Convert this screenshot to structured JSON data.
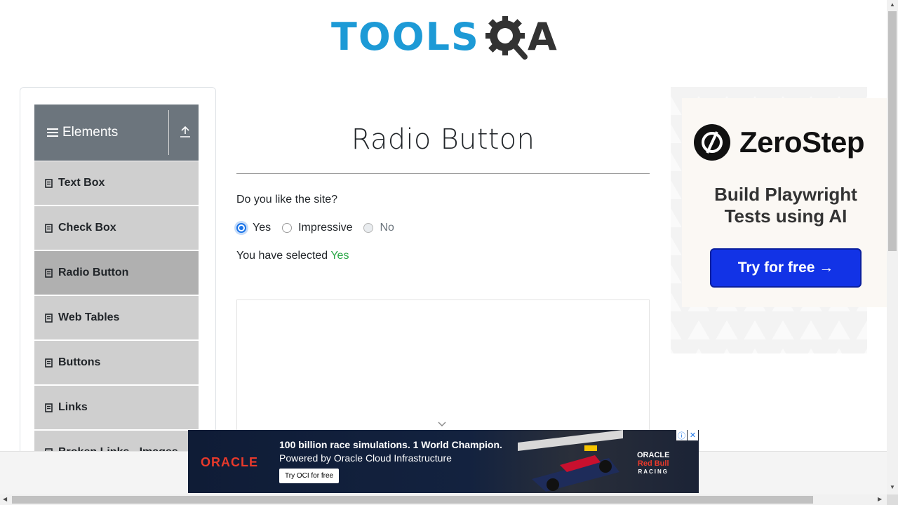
{
  "logo": {
    "tools": "TOOLS",
    "qa_a": "A"
  },
  "sidebar": {
    "group_title": "Elements",
    "items": [
      {
        "label": "Text Box"
      },
      {
        "label": "Check Box"
      },
      {
        "label": "Radio Button",
        "active": true
      },
      {
        "label": "Web Tables"
      },
      {
        "label": "Buttons"
      },
      {
        "label": "Links"
      },
      {
        "label": "Broken Links - Images"
      }
    ]
  },
  "main": {
    "title": "Radio Button",
    "question": "Do you like the site?",
    "options": [
      {
        "label": "Yes",
        "checked": true,
        "disabled": false
      },
      {
        "label": "Impressive",
        "checked": false,
        "disabled": false
      },
      {
        "label": "No",
        "checked": false,
        "disabled": true
      }
    ],
    "result_prefix": "You have selected ",
    "result_value": "Yes"
  },
  "ad_right": {
    "brand": "ZeroStep",
    "headline_1": "Build Playwright",
    "headline_2": "Tests using AI",
    "cta": "Try for free →"
  },
  "ad_bottom": {
    "brand": "ORACLE",
    "line_1": "100 billion race simulations. 1 World Champion.",
    "line_2": "Powered by Oracle Cloud Infrastructure",
    "cta": "Try OCI for free",
    "partner_1": "ORACLE",
    "partner_2": "Red Bull",
    "partner_3": "RACING",
    "info_glyph": "ⓘ",
    "close_glyph": "✕"
  },
  "colors": {
    "accent": "#1a73e8",
    "success": "#28a745",
    "sidebar_header": "#6c757d",
    "menu_bg": "#cfcfcf",
    "menu_active": "#b0b0b0"
  }
}
